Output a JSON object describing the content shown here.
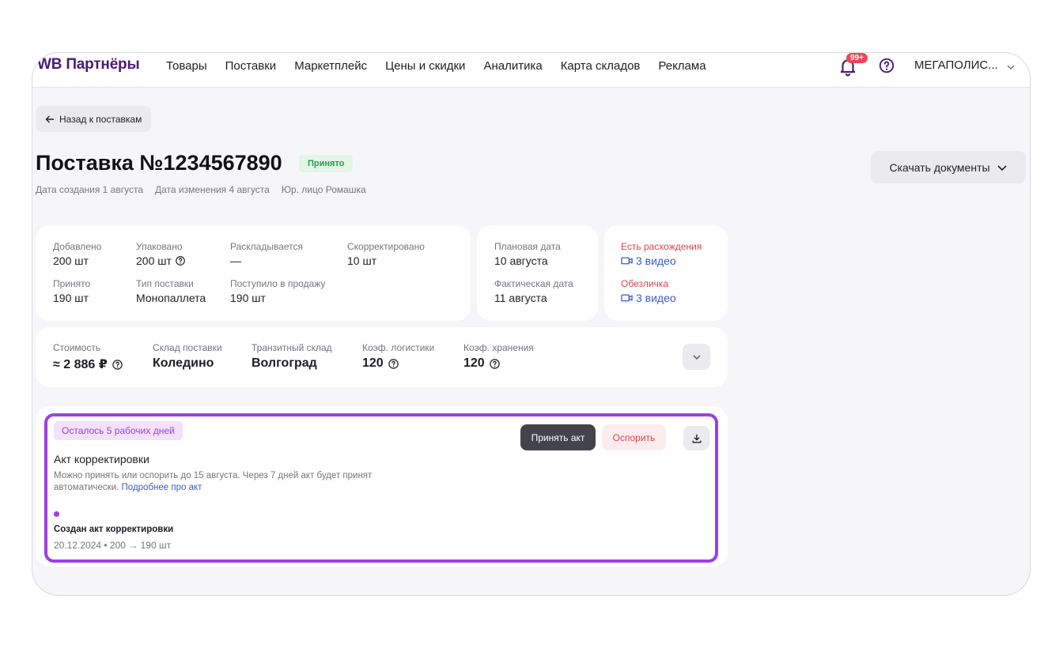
{
  "header": {
    "logo": "WB Партнёры",
    "nav": [
      "Товары",
      "Поставки",
      "Маркетплейс",
      "Цены и скидки",
      "Аналитика",
      "Карта складов",
      "Реклама"
    ],
    "notifications_badge": "99+",
    "account": "МЕГАПОЛИС..."
  },
  "back_button": "Назад к поставкам",
  "supply": {
    "title": "Поставка №1234567890",
    "status": "Принято",
    "meta": [
      "Дата создания 1 августа",
      "Дата изменения 4 августа",
      "Юр. лицо Ромашка"
    ]
  },
  "download_docs": "Скачать документы",
  "stats": {
    "added_label": "Добавлено",
    "added_value": "200 шт",
    "packed_label": "Упаковано",
    "packed_value": "200 шт",
    "sorting_label": "Раскладывается",
    "sorting_value": "—",
    "corrected_label": "Скорректировано",
    "corrected_value": "10 шт",
    "accepted_label": "Принято",
    "accepted_value": "190 шт",
    "type_label": "Тип поставки",
    "type_value": "Монопаллета",
    "on_sale_label": "Поступило в продажу",
    "on_sale_value": "190 шт"
  },
  "dates": {
    "planned_label": "Плановая дата",
    "planned_value": "10 августа",
    "actual_label": "Фактическая дата",
    "actual_value": "11 августа"
  },
  "issues": {
    "discrepancy_label": "Есть расхождения",
    "discrepancy_video": "3 видео",
    "depersonal_label": "Обезличка",
    "depersonal_video": "3 видео"
  },
  "costs": {
    "cost_label": "Стоимость",
    "cost_value": "≈ 2 886 ₽",
    "warehouse_label": "Склад поставки",
    "warehouse_value": "Коледино",
    "transit_label": "Транзитный склад",
    "transit_value": "Волгоград",
    "logistics_label": "Коэф. логистики",
    "logistics_value": "120",
    "storage_label": "Коэф. хранения",
    "storage_value": "120"
  },
  "act": {
    "days_left": "Осталось 5 рабочих дней",
    "accept": "Принять акт",
    "dispute": "Оспорить",
    "title": "Акт корректировки",
    "desc": "Можно принять или оспорить до 15 августа. Через 7 дней акт будет принят автоматически.",
    "link": "Подробнее про акт",
    "history_title": "Создан акт корректировки",
    "history_meta": "20.12.2024 • 200 → 190 шт"
  },
  "colors": {
    "accent": "#9b3fe6",
    "logo": "#4a1a7a",
    "status_green": "#27a04a",
    "danger": "#e0424f",
    "link": "#3a5bd0"
  }
}
